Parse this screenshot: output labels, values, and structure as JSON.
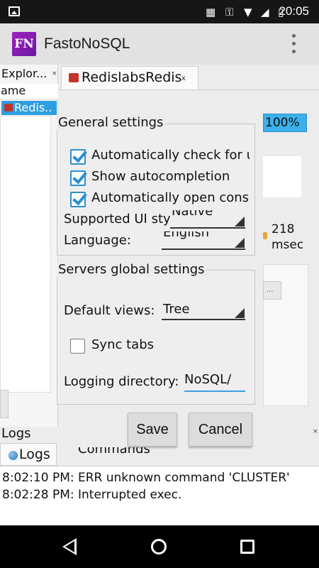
{
  "status_bar": {
    "time": "20:05"
  },
  "app_bar": {
    "logo": "FN",
    "title": "FastoNoSQL"
  },
  "explorer": {
    "title": "Explor...",
    "column_header": "ame",
    "item": "Redis.."
  },
  "tab": {
    "label": "RedislabsRedis",
    "close": "x"
  },
  "right": {
    "progress": "100%",
    "ms_value": "218",
    "ms_unit": "msec",
    "btn": "..."
  },
  "general": {
    "title": "General settings",
    "auto_check": "Automatically check for u",
    "show_autocomplete": "Show autocompletion",
    "auto_open": "Automatically open conso",
    "ui_style_label": "Supported UI sty",
    "ui_style_value": "Native",
    "language_label": "Language:",
    "language_value": "English"
  },
  "servers": {
    "title": "Servers global settings",
    "default_views_label": "Default views:",
    "default_views_value": "Tree",
    "sync_tabs": "Sync tabs",
    "logging_label": "Logging directory:",
    "logging_value": "NoSQL/"
  },
  "buttons": {
    "save": "Save",
    "cancel": "Cancel"
  },
  "logs": {
    "title": "Logs",
    "tab_logs": "Logs",
    "tab_commands": "Commands",
    "lines": [
      "8:02:10 PM: ERR unknown command 'CLUSTER'",
      "8:02:28 PM: Interrupted exec."
    ]
  }
}
